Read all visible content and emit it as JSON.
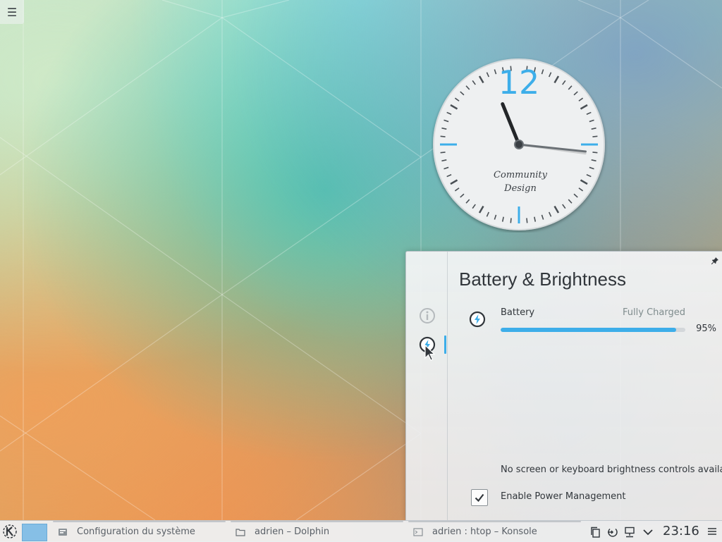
{
  "desktop": {
    "menu_icon": "hamburger-icon",
    "menu_glyph": "☰"
  },
  "clock_widget": {
    "number": "12",
    "brand_line1": "Community",
    "brand_line2": "Design",
    "time": {
      "hour": 11,
      "minute": 16
    }
  },
  "popup": {
    "title": "Battery & Brightness",
    "pin_icon": "pin-icon",
    "sidebar": [
      {
        "name": "info-icon",
        "active": false
      },
      {
        "name": "battery-icon",
        "active": true
      }
    ],
    "battery": {
      "label": "Battery",
      "status": "Fully Charged",
      "percent_text": "95%",
      "level_fraction": 0.95
    },
    "brightness_message": "No screen or keyboard brightness controls available",
    "power_management": {
      "label": "Enable Power Management",
      "checked": true
    }
  },
  "taskbar": {
    "launcher_icon": "kde-logo-icon",
    "tasks": [
      {
        "label": "Configuration du système",
        "icon": "settings-icon"
      },
      {
        "label": "adrien – Dolphin",
        "icon": "folder-icon"
      },
      {
        "label": "adrien : htop – Konsole",
        "icon": "terminal-icon"
      }
    ],
    "tray": {
      "icons": [
        "clipboard-icon",
        "power-icon",
        "network-icon",
        "chevron-down-icon"
      ],
      "clock": "23:16",
      "menu_icon": "hamburger-icon"
    }
  },
  "colors": {
    "accent": "#3daee9",
    "text": "#31363b",
    "muted": "#7f8c8d"
  }
}
